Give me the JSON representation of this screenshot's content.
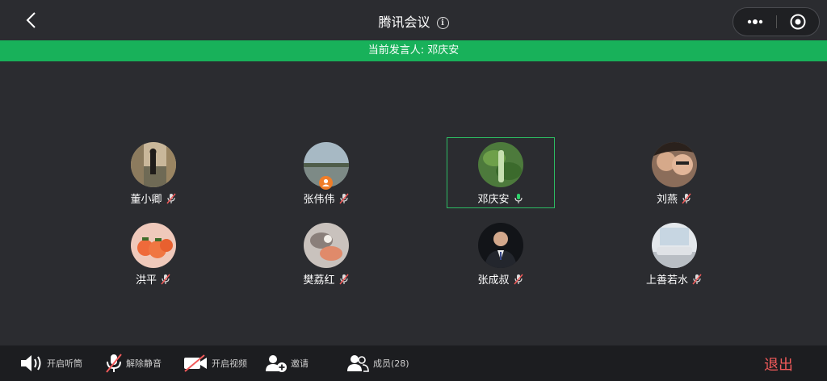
{
  "header": {
    "title": "腾讯会议"
  },
  "banner": {
    "label": "当前发言人:",
    "speaker": "邓庆安"
  },
  "participants": [
    {
      "name": "董小卿",
      "muted": true
    },
    {
      "name": "张伟伟",
      "muted": true
    },
    {
      "name": "邓庆安",
      "muted": false,
      "speaking": true
    },
    {
      "name": "刘燕",
      "muted": true
    },
    {
      "name": "洪平",
      "muted": true
    },
    {
      "name": "樊荔红",
      "muted": true
    },
    {
      "name": "张成叔",
      "muted": true
    },
    {
      "name": "上善若水",
      "muted": true
    }
  ],
  "toolbar": {
    "speaker_label": "开启听筒",
    "unmute_label": "解除静音",
    "video_label": "开启视频",
    "invite_label": "邀请",
    "members_label": "成员(28)",
    "exit_label": "退出"
  },
  "colors": {
    "accent_green": "#18b15a",
    "exit_red": "#f25a5a",
    "background": "#2b2c30"
  }
}
